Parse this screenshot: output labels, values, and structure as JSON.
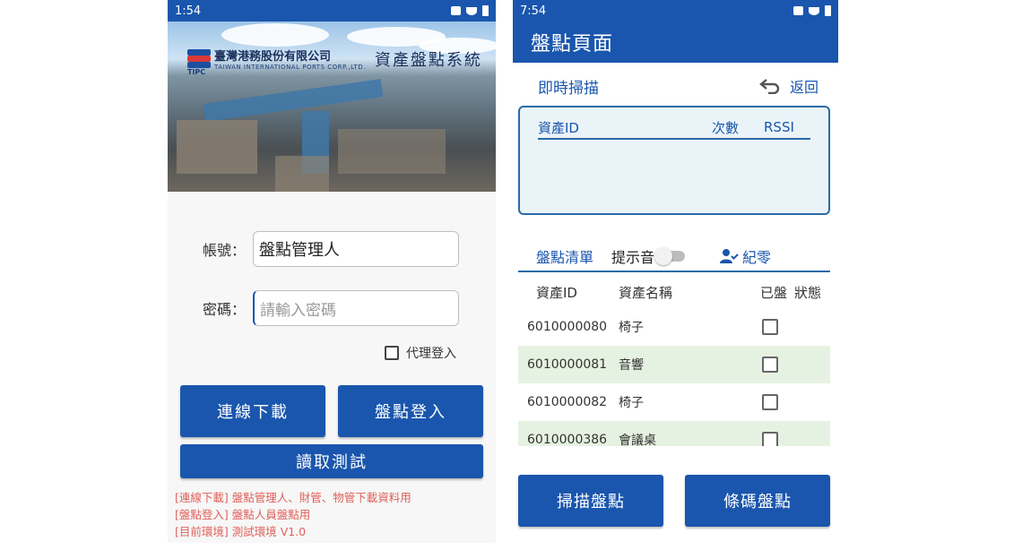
{
  "login": {
    "status": {
      "time": "1:54"
    },
    "hero": {
      "company": "臺灣港務股份有限公司",
      "company_en": "TAIWAN INTERNATIONAL PORTS CORP.,LTD.",
      "logo_text": "TIPC",
      "system_title": "資產盤點系統"
    },
    "account": {
      "label": "帳號：",
      "value": "盤點管理人"
    },
    "password": {
      "label": "密碼：",
      "placeholder": "請輸入密碼"
    },
    "proxy_label": "代理登入",
    "buttons": {
      "download": "連線下載",
      "login": "盤點登入",
      "read_test": "讀取測試"
    },
    "notes": [
      "[連線下載] 盤點管理人、財管、物管下載資料用",
      "[盤點登入] 盤點人員盤點用",
      "[目前環境] 測試環境 V1.0"
    ]
  },
  "inventory": {
    "status": {
      "time": "7:54"
    },
    "title": "盤點頁面",
    "scan_title": "即時掃描",
    "back_label": "返回",
    "scan_columns": {
      "id": "資產ID",
      "count": "次數",
      "rssi": "RSSI"
    },
    "list_title": "盤點清單",
    "beep_label": "提示音",
    "record_label": "紀零",
    "list_columns": {
      "id": "資產ID",
      "name": "資產名稱",
      "done": "已盤",
      "state": "狀態"
    },
    "rows": [
      {
        "id": "6010000080",
        "name": "椅子"
      },
      {
        "id": "6010000081",
        "name": "音響"
      },
      {
        "id": "6010000082",
        "name": "椅子"
      },
      {
        "id": "6010000386",
        "name": "會議桌"
      }
    ],
    "buttons": {
      "scan": "掃描盤點",
      "barcode": "條碼盤點"
    }
  },
  "colors": {
    "primary": "#1a56ad",
    "note": "#e0605a",
    "alt_row": "#e6f2e1"
  }
}
